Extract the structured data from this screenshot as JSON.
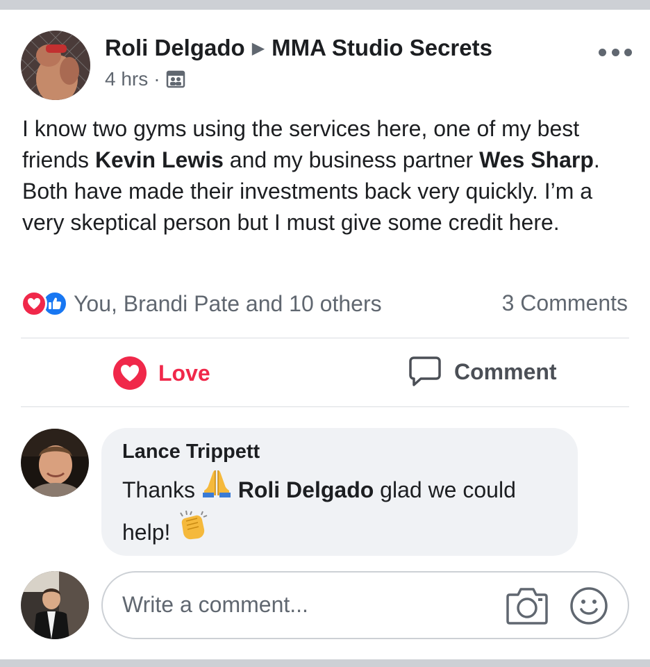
{
  "post": {
    "author": "Roli Delgado",
    "arrow": "▶",
    "group": "MMA Studio Secrets",
    "time": "4 hrs",
    "separator": "·",
    "privacy_icon": "group-privacy-icon",
    "more_icon": "more-options-icon",
    "body": {
      "t1": "I know two gyms using the services here, one of my best friends ",
      "mention1": "Kevin Lewis",
      "t2": " and my business partner ",
      "mention2": "Wes Sharp",
      "t3": ".  Both have made their investments back very quickly.  I’m a very skeptical person but I must give some credit here."
    },
    "reactions_text": "You, Brandi Pate and 10 others",
    "comments_count": "3 Comments"
  },
  "actions": {
    "love_label": "Love",
    "comment_label": "Comment"
  },
  "comment": {
    "author": "Lance Trippett",
    "text_before": "Thanks ",
    "emoji1": "🙏",
    "mention": "Roli Delgado",
    "text_middle": " glad we could help! ",
    "emoji2": "👏"
  },
  "composer": {
    "placeholder": "Write a comment..."
  },
  "colors": {
    "love": "#f0284a",
    "like": "#1877f2",
    "secondary_text": "#606770",
    "bubble": "#f0f2f5",
    "divider": "#dadde1"
  }
}
